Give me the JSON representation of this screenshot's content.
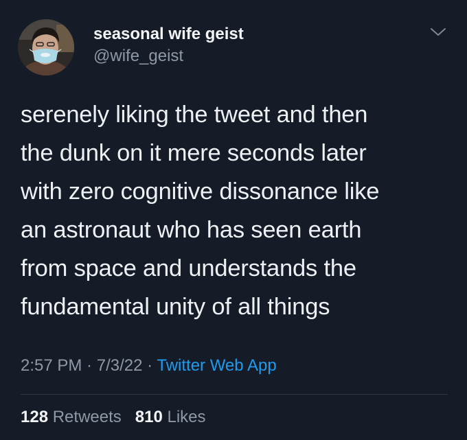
{
  "author": {
    "display_name": "seasonal wife geist",
    "handle": "@wife_geist",
    "avatar_icon": "profile-photo-masked-person"
  },
  "menu_icon": "chevron-down-icon",
  "tweet": {
    "lines": [
      "serenely liking the tweet and then",
      "the dunk on it mere seconds later",
      "with zero cognitive dissonance like",
      "an astronaut who has seen earth",
      "from space and understands the",
      "fundamental unity of all things"
    ]
  },
  "meta": {
    "time": "2:57 PM",
    "separator1": " · ",
    "date": "7/3/22",
    "separator2": " · ",
    "source": "Twitter Web App"
  },
  "stats": {
    "retweets_count": "128",
    "retweets_label": "Retweets",
    "likes_count": "810",
    "likes_label": "Likes"
  },
  "colors": {
    "background": "#151c27",
    "text": "#eef1f4",
    "muted": "#8d99a6",
    "accent": "#1d9bf0",
    "divider": "#2f3844"
  }
}
